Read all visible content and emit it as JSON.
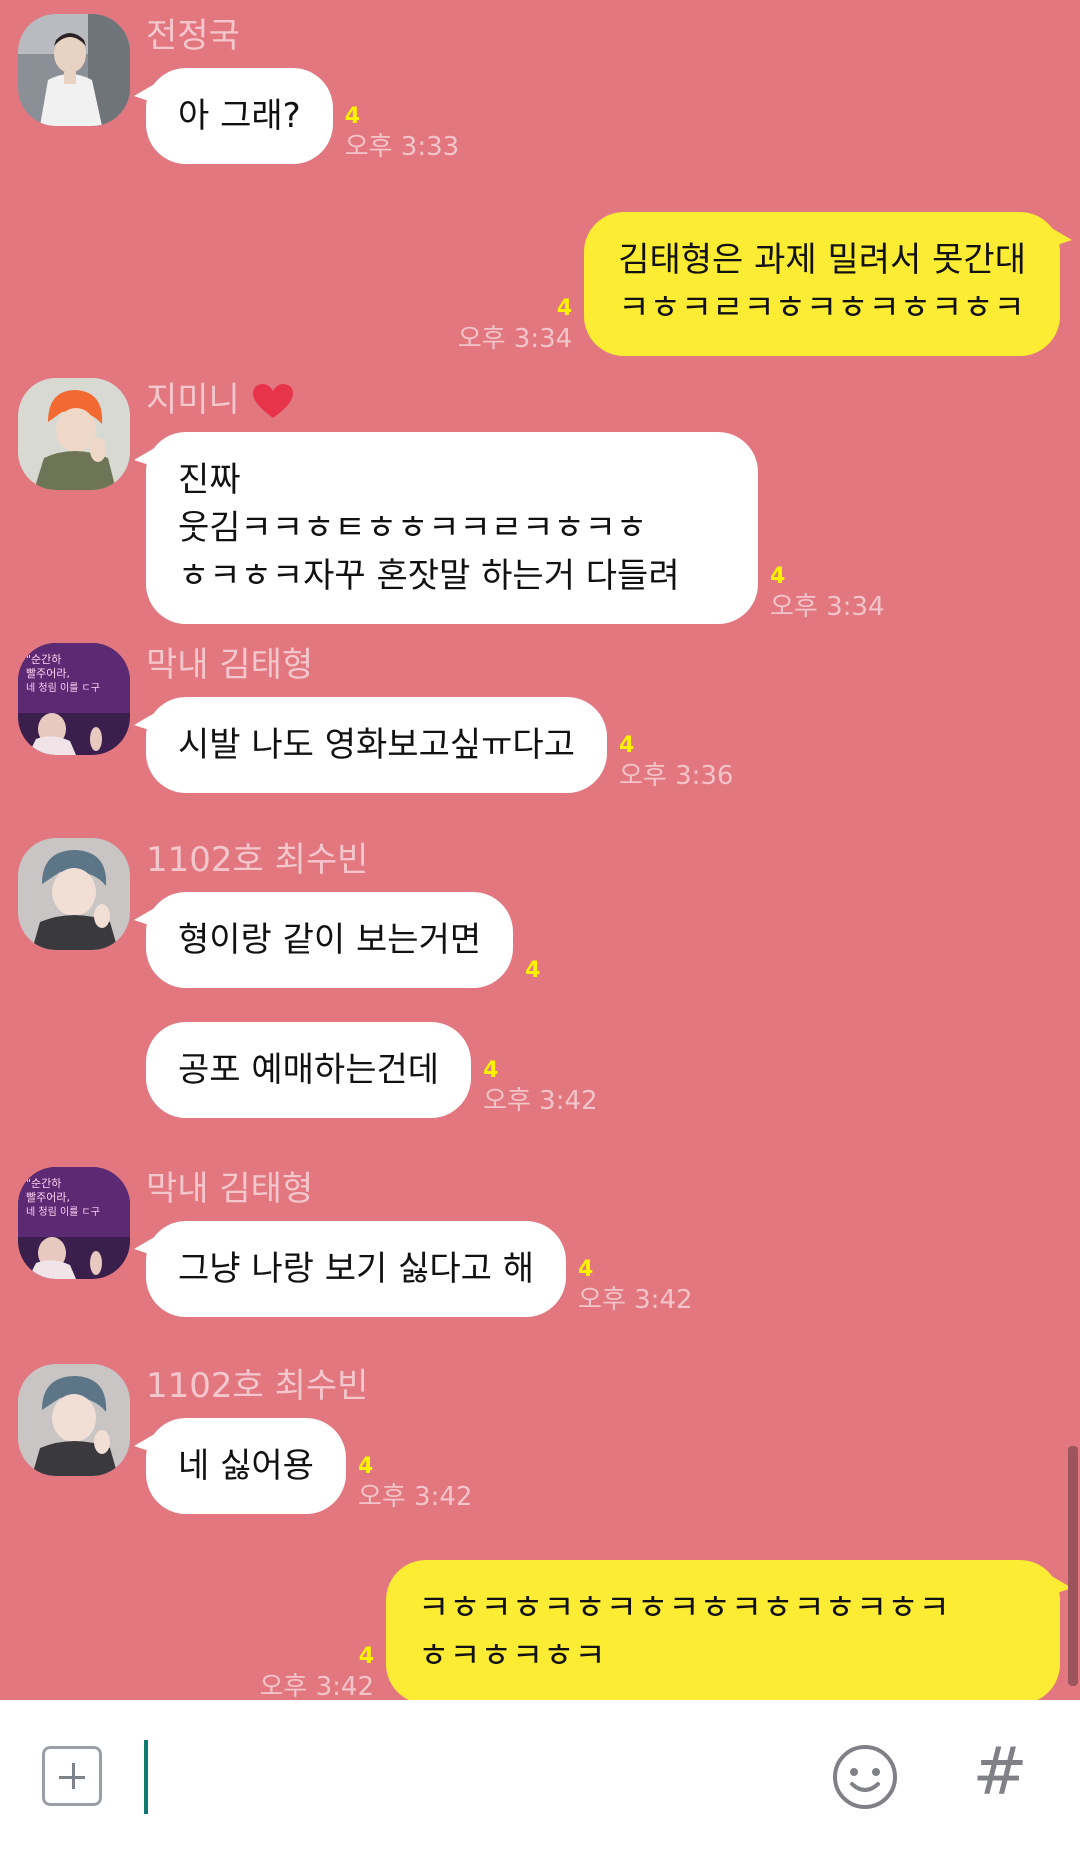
{
  "colors": {
    "background": "#e27780",
    "incoming_bubble": "#ffffff",
    "outgoing_bubble": "#fcec33",
    "unread_count": "#fff200",
    "timestamp": "#f3c4c9",
    "sender_name": "#f4c7cc"
  },
  "messages": [
    {
      "sender": "전정국",
      "text": "아 그래?",
      "unread": "4",
      "time": "오후 3:33"
    },
    {
      "text_lines": [
        "김태형은 과제 밀려서 못간대",
        "ㅋㅎㅋㄹㅋㅎㅋㅎㅋㅎㅋㅎㅋ"
      ],
      "unread": "4",
      "time": "오후 3:34"
    },
    {
      "sender": "지미니",
      "text_lines": [
        "진짜",
        "웃김ㅋㅋㅎㅌㅎㅎㅋㅋㄹㅋㅎㅋㅎ",
        "ㅎㅋㅎㅋ자꾸 혼잣말 하는거 다들려"
      ],
      "unread": "4",
      "time": "오후 3:34"
    },
    {
      "sender": "막내 김태형",
      "text": "시발 나도 영화보고싶ㅠ다고",
      "unread": "4",
      "time": "오후 3:36"
    },
    {
      "sender": "1102호 최수빈",
      "text": "형이랑 같이 보는거면",
      "unread": "4"
    },
    {
      "text": "공포 예매하는건데",
      "unread": "4",
      "time": "오후 3:42"
    },
    {
      "sender": "막내 김태형",
      "text": "그냥 나랑 보기 싫다고 해",
      "unread": "4",
      "time": "오후 3:42"
    },
    {
      "sender": "1102호 최수빈",
      "text": "네 싫어용",
      "unread": "4",
      "time": "오후 3:42"
    },
    {
      "text_lines": [
        "ㅋㅎㅋㅎㅋㅎㅋㅎㅋㅎㅋㅎㅋㅎㅋㅎㅋ",
        "ㅎㅋㅎㅋㅎㅋ"
      ],
      "unread": "4",
      "time": "오후 3:42"
    }
  ],
  "avatar_texts": {
    "taehyung_avatar": [
      "\"순간하",
      "빨주어라,",
      "네 청림 이를 ㄷ구"
    ]
  },
  "input_bar": {
    "plus_icon": "plus-square-icon",
    "emoji_icon": "emoji-face-icon",
    "hash_label": "#"
  }
}
